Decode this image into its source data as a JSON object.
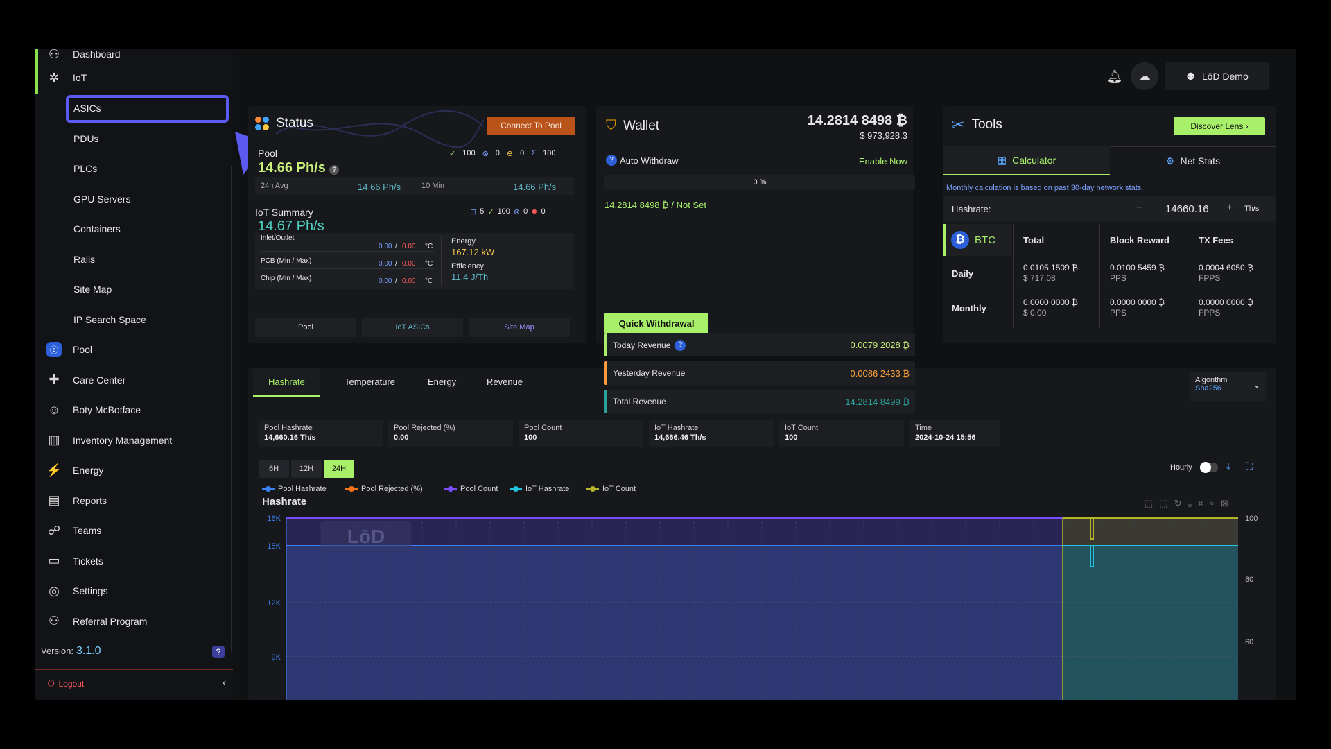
{
  "sidebar": {
    "top_items": [
      {
        "label": "Dashboard",
        "icon": "dashboard-icon"
      },
      {
        "label": "IoT",
        "icon": "iot-icon"
      }
    ],
    "iot_sub": [
      "ASICs",
      "PDUs",
      "PLCs",
      "GPU Servers",
      "Containers",
      "Rails",
      "Site Map",
      "IP Search Space"
    ],
    "items": [
      {
        "label": "Pool",
        "icon": "pool-icon"
      },
      {
        "label": "Care Center",
        "icon": "care-center-icon"
      },
      {
        "label": "Boty McBotface",
        "icon": "bot-icon"
      },
      {
        "label": "Inventory Management",
        "icon": "inventory-icon"
      },
      {
        "label": "Energy",
        "icon": "energy-icon"
      },
      {
        "label": "Reports",
        "icon": "reports-icon"
      },
      {
        "label": "Teams",
        "icon": "teams-icon"
      },
      {
        "label": "Tickets",
        "icon": "tickets-icon"
      },
      {
        "label": "Settings",
        "icon": "settings-icon"
      },
      {
        "label": "Referral Program",
        "icon": "referral-icon"
      }
    ],
    "version_label": "Version:",
    "version": "3.1.0",
    "logout": "Logout"
  },
  "header": {
    "user": "LōD Demo"
  },
  "status": {
    "title": "Status",
    "connect_btn": "Connect To Pool",
    "pool_label": "Pool",
    "pool_counts": [
      "100",
      "0",
      "0",
      "100"
    ],
    "pool_hashrate": "14.66 Ph/s",
    "avg_label": "24h Avg",
    "avg_value": "14.66 Ph/s",
    "ten_label": "10 Min",
    "ten_value": "14.66 Ph/s",
    "iot_label": "IoT Summary",
    "iot_counts": [
      "5",
      "100",
      "0",
      "0"
    ],
    "iot_hashrate": "14.67 Ph/s",
    "temps": [
      {
        "label": "Inlet/Outlet",
        "min": "0.00",
        "max": "0.00",
        "unit": "°C"
      },
      {
        "label": "PCB (Min / Max)",
        "min": "0.00",
        "max": "0.00",
        "unit": "°C"
      },
      {
        "label": "Chip (Min / Max)",
        "min": "0.00",
        "max": "0.00",
        "unit": "°C"
      }
    ],
    "energy_label": "Energy",
    "energy_value": "167.12 kW",
    "eff_label": "Efficiency",
    "eff_value": "11.4 J/Th",
    "tabs": [
      "Pool",
      "IoT ASICs",
      "Site Map"
    ]
  },
  "wallet": {
    "title": "Wallet",
    "balance": "14.2814 8498 ₿",
    "usd": "$ 973,928.3",
    "auto_label": "Auto Withdraw",
    "enable": "Enable Now",
    "progress_text": "0 %",
    "progress": 0,
    "not_set": "14.2814 8498 ₿ / Not Set",
    "rows": [
      {
        "label": "Today Revenue",
        "value": "0.0079 2028 ₿"
      },
      {
        "label": "Yesterday Revenue",
        "value": "0.0086 2433 ₿"
      },
      {
        "label": "Total Revenue",
        "value": "14.2814 8499 ₿"
      }
    ],
    "withdraw_btn": "Quick Withdrawal"
  },
  "tools": {
    "title": "Tools",
    "discover_btn": "Discover Lens",
    "tabs": [
      "Calculator",
      "Net Stats"
    ],
    "note": "Monthly calculation is based on past 30-day network stats.",
    "hashrate_label": "Hashrate:",
    "hashrate_value": "14660.16",
    "hashrate_unit": "Th/s",
    "coin": "BTC",
    "cols": [
      "Total",
      "Block Reward",
      "TX Fees"
    ],
    "rows": [
      {
        "label": "Daily",
        "cells": [
          [
            "0.0105 1509 ₿",
            "$ 717.08"
          ],
          [
            "0.0100 5459 ₿",
            "PPS"
          ],
          [
            "0.0004 6050 ₿",
            "FPPS"
          ]
        ]
      },
      {
        "label": "Monthly",
        "cells": [
          [
            "0.0000 0000 ₿",
            "$ 0.00"
          ],
          [
            "0.0000 0000 ₿",
            "PPS"
          ],
          [
            "0.0000 0000 ₿",
            "FPPS"
          ]
        ]
      }
    ]
  },
  "charts": {
    "tabs": [
      "Hashrate",
      "Temperature",
      "Energy",
      "Revenue"
    ],
    "algo_label": "Algorithm",
    "algo_value": "Sha256",
    "stats": [
      {
        "label": "Pool Hashrate",
        "value": "14,660.16 Th/s"
      },
      {
        "label": "Pool Rejected (%)",
        "value": "0.00"
      },
      {
        "label": "Pool Count",
        "value": "100"
      },
      {
        "label": "IoT Hashrate",
        "value": "14,666.46 Th/s"
      },
      {
        "label": "IoT Count",
        "value": "100"
      },
      {
        "label": "Time",
        "value": "2024-10-24 15:56"
      }
    ],
    "ranges": [
      "6H",
      "12H",
      "24H"
    ],
    "hourly": "Hourly",
    "chart_title": "Hashrate",
    "watermark": "LōD"
  },
  "chart_data": {
    "type": "area",
    "title": "Hashrate",
    "y_left_ticks": [
      "16K",
      "15K",
      "12K",
      "9K"
    ],
    "y_right_ticks": [
      "100",
      "80",
      "60"
    ],
    "ylim_left": [
      0,
      16000
    ],
    "ylim_right": [
      0,
      100
    ],
    "series": [
      {
        "name": "Pool Hashrate",
        "color": "#3b82f6",
        "value": 14660
      },
      {
        "name": "Pool Rejected (%)",
        "color": "#f97316",
        "value": 0
      },
      {
        "name": "Pool Count",
        "color": "#7c4dff",
        "value": 100
      },
      {
        "name": "IoT Hashrate",
        "color": "#22c4e0",
        "value": 14666
      },
      {
        "name": "IoT Count",
        "color": "#b5b52a",
        "value": 100
      }
    ]
  },
  "colors": {
    "accent": "#a8f06a",
    "highlight": "#5a5af0",
    "orange_btn": "#b9531a"
  }
}
